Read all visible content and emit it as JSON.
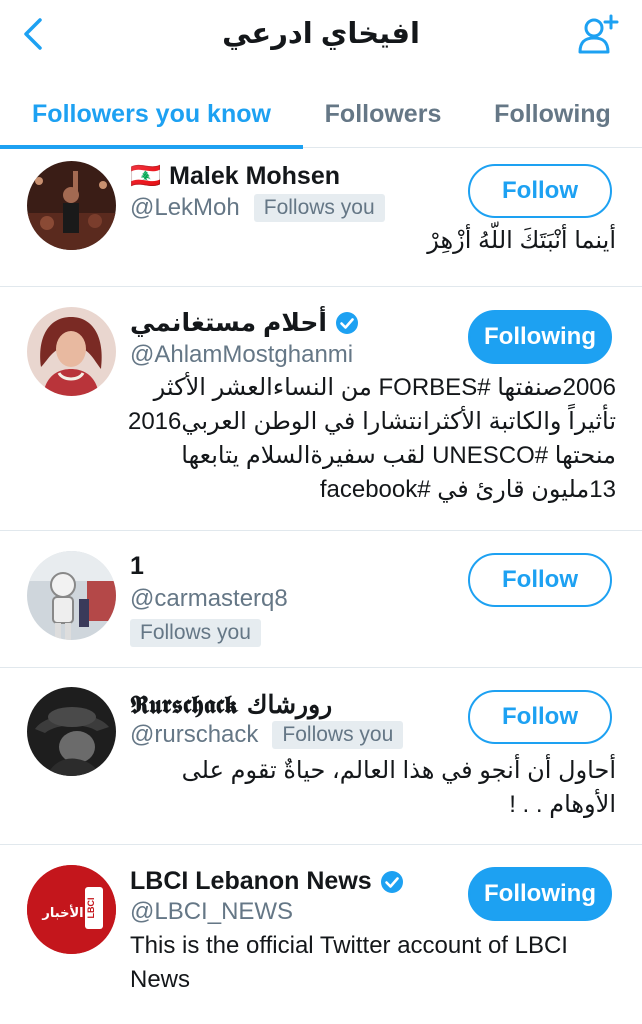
{
  "header": {
    "title": "افيخاي ادرعي",
    "back_icon": "chevron-left-icon",
    "add_user_icon": "add-user-icon",
    "accent": "#1da1f2"
  },
  "tabs": [
    {
      "label": "Followers you know",
      "active": true
    },
    {
      "label": "Followers",
      "active": false
    },
    {
      "label": "Following",
      "active": false
    }
  ],
  "users": [
    {
      "flag": "🇱🇧",
      "name": "Malek Mohsen",
      "handle": "@LekMoh",
      "follows_you": "Follows you",
      "bio": "أينما أنْبَتَكَ اللّهُ أزْهِرْ",
      "button": "Follow"
    },
    {
      "name": "أحلام مستغانمي",
      "verified": true,
      "handle": "@AhlamMostghanmi",
      "bio": "2006صنفتها #FORBES من النساءالعشر الأكثر تأثيراً والكاتبة الأكثرانتشارا في الوطن العربي2016 منحتها #UNESCO لقب سفيرةالسلام يتابعها 13مليون قارئ في #facebook",
      "button": "Following"
    },
    {
      "name": "1",
      "handle": "@carmasterq8",
      "follows_you": "Follows you",
      "button": "Follow"
    },
    {
      "name": "𝕽𝖚𝖗𝖘𝖈𝖍𝖆𝖈𝖐 رورشاك",
      "handle": "@rurschack",
      "follows_you": "Follows you",
      "bio": "أحاول أن أنجو في هذا العالم، حياةٌ تقوم على الأوهام . . !",
      "button": "Follow"
    },
    {
      "name": "LBCI Lebanon News",
      "verified": true,
      "handle": "@LBCI_NEWS",
      "bio": "This is the official Twitter account of LBCI News",
      "logo_text": "الأخبار",
      "logo_mark": "LBCI",
      "button": "Following"
    }
  ]
}
